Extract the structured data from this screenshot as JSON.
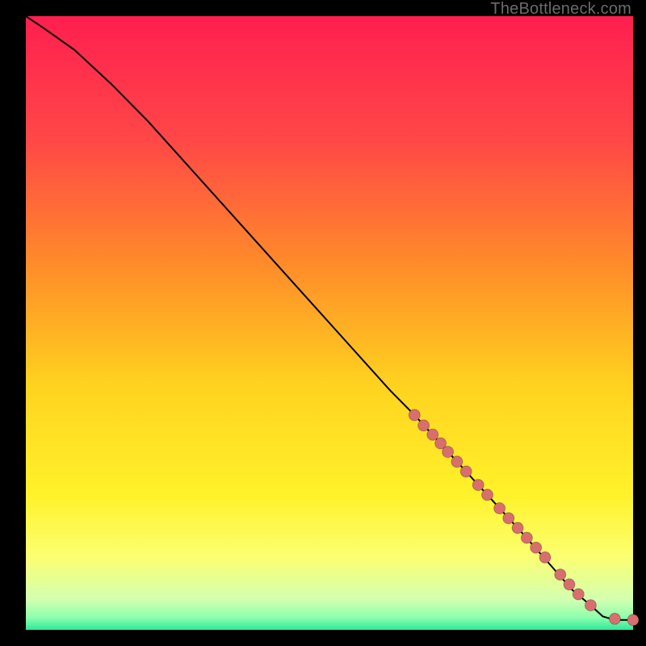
{
  "watermark": "TheBottleneck.com",
  "colors": {
    "gradient_stops": [
      {
        "pct": 0,
        "color": "#ff1f4f"
      },
      {
        "pct": 20,
        "color": "#ff4747"
      },
      {
        "pct": 40,
        "color": "#ff8a2a"
      },
      {
        "pct": 60,
        "color": "#ffd21f"
      },
      {
        "pct": 78,
        "color": "#fff22a"
      },
      {
        "pct": 88,
        "color": "#fcff70"
      },
      {
        "pct": 95,
        "color": "#d4ffb0"
      },
      {
        "pct": 98,
        "color": "#8cffad"
      },
      {
        "pct": 100,
        "color": "#2fe89a"
      }
    ],
    "point_fill": "#d96e6e",
    "curve_stroke": "#000000"
  },
  "chart_data": {
    "type": "line",
    "title": "",
    "xlabel": "",
    "ylabel": "",
    "xlim": [
      0,
      100
    ],
    "ylim": [
      0,
      100
    ],
    "grid": false,
    "series": [
      {
        "name": "bottleneck-curve",
        "kind": "line",
        "x": [
          0,
          3,
          8,
          14,
          20,
          30,
          40,
          50,
          60,
          64,
          70,
          76,
          82,
          86,
          90,
          93,
          95,
          97,
          100
        ],
        "y": [
          100,
          98,
          94.5,
          89,
          83,
          72,
          61,
          50,
          39,
          35,
          28.5,
          22,
          15.5,
          11,
          6.5,
          4,
          2.2,
          1.6,
          1.6
        ]
      },
      {
        "name": "measured-points",
        "kind": "scatter",
        "x": [
          64,
          65.5,
          67,
          68.3,
          69.5,
          71,
          72.5,
          74.5,
          76,
          78,
          79.5,
          81,
          82.5,
          84,
          85.5,
          88,
          89.5,
          91,
          93,
          97,
          100
        ],
        "y": [
          35,
          33.3,
          31.8,
          30.4,
          29,
          27.4,
          25.8,
          23.6,
          22,
          19.8,
          18.2,
          16.6,
          15,
          13.4,
          11.8,
          9,
          7.4,
          5.8,
          4,
          1.8,
          1.6
        ]
      }
    ],
    "point_radius_px": 7
  }
}
